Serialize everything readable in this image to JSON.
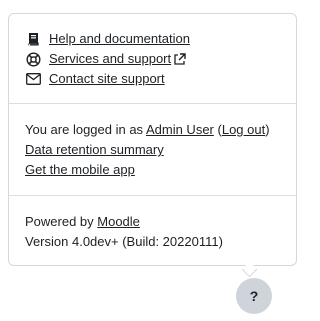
{
  "menu": {
    "help": {
      "icon": "book-icon",
      "label": "Help and documentation"
    },
    "services": {
      "icon": "lifebuoy-icon",
      "label": "Services and support",
      "ext_icon": "external-link-icon"
    },
    "contact": {
      "icon": "envelope-icon",
      "label": "Contact site support"
    }
  },
  "login": {
    "prefix": "You are logged in as ",
    "user": "Admin User",
    "open_paren": " (",
    "logout": "Log out",
    "close_paren": ")"
  },
  "links": {
    "data_retention": "Data retention summary",
    "mobile_app": "Get the mobile app"
  },
  "footer": {
    "powered_prefix": "Powered by ",
    "moodle": "Moodle",
    "version": "Version 4.0dev+ (Build: 20220111)"
  },
  "help_button": {
    "label": "?"
  }
}
